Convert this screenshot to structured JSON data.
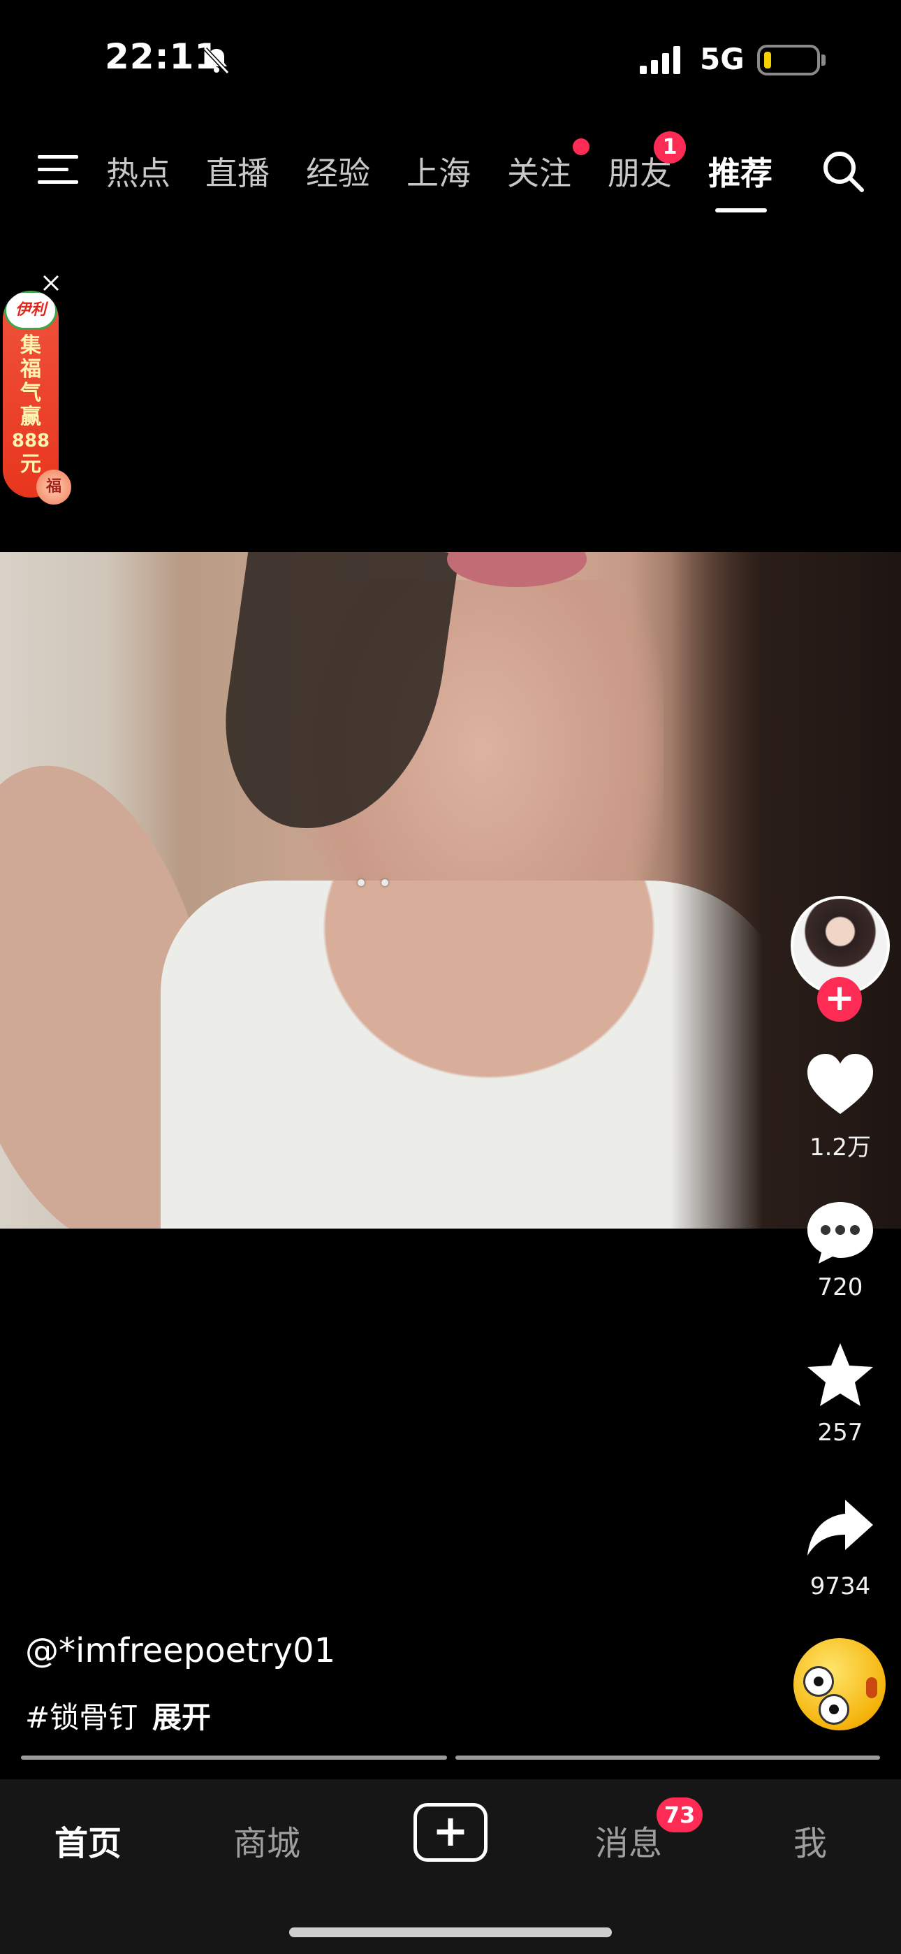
{
  "status_bar": {
    "time": "22:11",
    "network": "5G",
    "battery_level": 0.1,
    "silent_icon": "bell-slash-icon"
  },
  "top_nav": {
    "menu_icon": "menu-icon",
    "tabs": [
      {
        "label": "热点"
      },
      {
        "label": "直播"
      },
      {
        "label": "经验"
      },
      {
        "label": "上海"
      },
      {
        "label": "关注"
      },
      {
        "label": "朋友"
      },
      {
        "label": "推荐"
      }
    ],
    "active_tab": "推荐",
    "friends_badge": "1",
    "search_icon": "search-icon"
  },
  "ad": {
    "brand": "伊利",
    "text_lines": [
      "集",
      "福",
      "气",
      "赢",
      "888",
      "元"
    ],
    "coin_label": "福"
  },
  "actions": {
    "like_count": "1.2万",
    "comment_count": "720",
    "favorite_count": "257",
    "share_count": "9734"
  },
  "caption": {
    "author": "@*imfreepoetry01",
    "hashtag": "#锁骨钉",
    "expand_label": "展开"
  },
  "bottom_nav": {
    "home": "首页",
    "mall": "商城",
    "create": "+",
    "messages": "消息",
    "messages_badge": "73",
    "me": "我"
  },
  "colors": {
    "accent": "#fe2c55",
    "background": "#000000",
    "nav_bg": "#161616"
  }
}
